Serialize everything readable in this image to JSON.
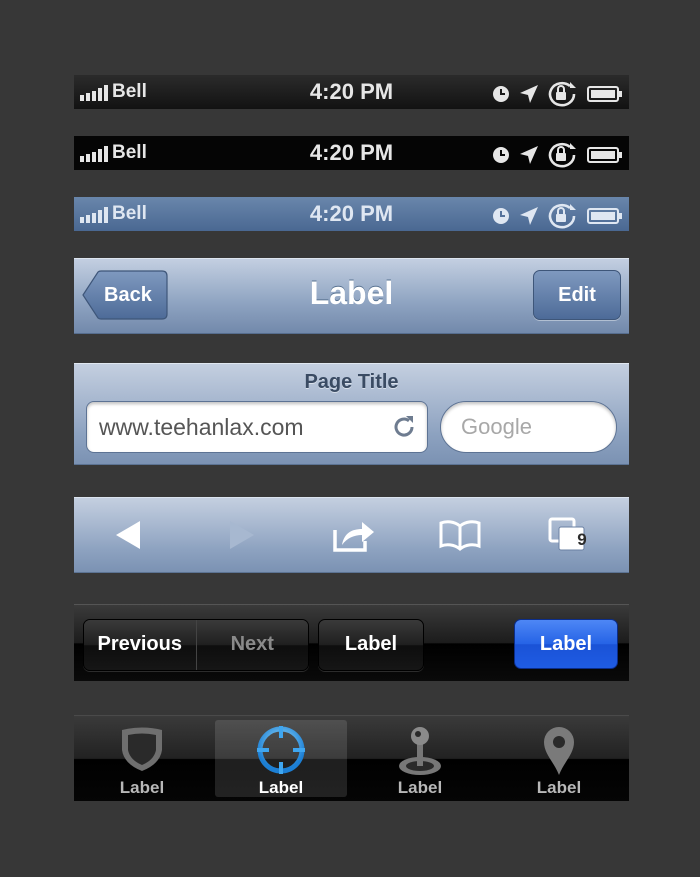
{
  "status_bars": [
    {
      "carrier": "Bell",
      "time": "4:20 PM",
      "style": "gradient-black"
    },
    {
      "carrier": "Bell",
      "time": "4:20 PM",
      "style": "opaque-black"
    },
    {
      "carrier": "Bell",
      "time": "4:20 PM",
      "style": "blue"
    }
  ],
  "status_icons": [
    "clock-icon",
    "location-arrow-icon",
    "rotation-lock-icon",
    "battery-icon"
  ],
  "navbar": {
    "back_label": "Back",
    "title": "Label",
    "edit_label": "Edit"
  },
  "urlbar": {
    "page_title": "Page Title",
    "url": "www.teehanlax.com",
    "search_placeholder": "Google"
  },
  "toolbar": {
    "items": [
      "back-arrow-icon",
      "forward-arrow-icon",
      "share-icon",
      "bookmarks-icon",
      "pages-icon"
    ],
    "pages_count": "9"
  },
  "black_toolbar": {
    "previous_label": "Previous",
    "next_label": "Next",
    "label_button": "Label",
    "blue_button": "Label"
  },
  "tabbar": {
    "tabs": [
      {
        "label": "Label",
        "icon": "shield-icon",
        "selected": false
      },
      {
        "label": "Label",
        "icon": "crosshair-icon",
        "selected": true
      },
      {
        "label": "Label",
        "icon": "joystick-icon",
        "selected": false
      },
      {
        "label": "Label",
        "icon": "map-pin-icon",
        "selected": false
      }
    ]
  },
  "colors": {
    "background": "#373737",
    "blue_accent": "#2563e6",
    "crosshair_blue": "#3fa6f0"
  }
}
